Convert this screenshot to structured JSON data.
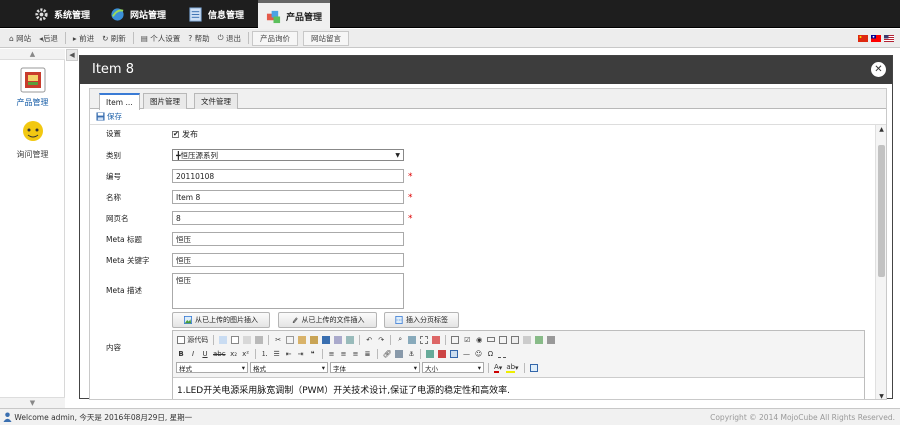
{
  "main_menu": [
    {
      "label": "系统管理",
      "icon": "gear-icon"
    },
    {
      "label": "网站管理",
      "icon": "globe-icon"
    },
    {
      "label": "信息管理",
      "icon": "document-icon"
    },
    {
      "label": "产品管理",
      "icon": "products-icon",
      "active": true
    }
  ],
  "toolbar": {
    "home": "网站",
    "back": "后退",
    "forward": "前进",
    "refresh": "刷新",
    "profile": "个人设置",
    "help": "帮助",
    "logout": "退出",
    "product_query": "产品询价",
    "site_message": "网站留言"
  },
  "flags": [
    "cn-flag-icon",
    "tw-flag-icon",
    "us-flag-icon"
  ],
  "sidebar": [
    {
      "label": "产品管理",
      "icon": "product-box-icon",
      "active": true
    },
    {
      "label": "询问管理",
      "icon": "chat-bubble-icon",
      "active": false
    }
  ],
  "dialog": {
    "title": "Item 8",
    "ghost_text": "",
    "tabs": [
      "Item ...",
      "图片管理",
      "文件管理"
    ],
    "save_label": "保存",
    "fields": {
      "settings_label": "设置",
      "publish_label": "发布",
      "publish_checked": true,
      "category_label": "类别",
      "category_value": "╋恒压源系列",
      "code_label": "编号",
      "code_value": "20110108",
      "name_label": "名称",
      "name_value": "Item 8",
      "pagename_label": "网页名",
      "pagename_value": "8",
      "meta_title_label": "Meta 标题",
      "meta_title_value": "恒压",
      "meta_keywords_label": "Meta 关键字",
      "meta_keywords_value": "恒压",
      "meta_desc_label": "Meta 描述",
      "meta_desc_value": "恒压",
      "content_label": "内容"
    },
    "insert_buttons": {
      "image": "从已上传的图片插入",
      "file": "从已上传的文件插入",
      "pagebreak": "插入分页标签"
    },
    "editor": {
      "source_label": "源代码",
      "style_label": "样式",
      "format_label": "格式",
      "font_label": "字体",
      "size_label": "大小",
      "content": "1.LED开关电源采用脉宽调制（PWM）开关技术设计,保证了电源的稳定性和高效率."
    }
  },
  "status": {
    "welcome": "Welcome admin, 今天是 2016年08月29日, 星期一",
    "copyright": "Copyright © 2014 MojoCube All Rights Reserved."
  }
}
